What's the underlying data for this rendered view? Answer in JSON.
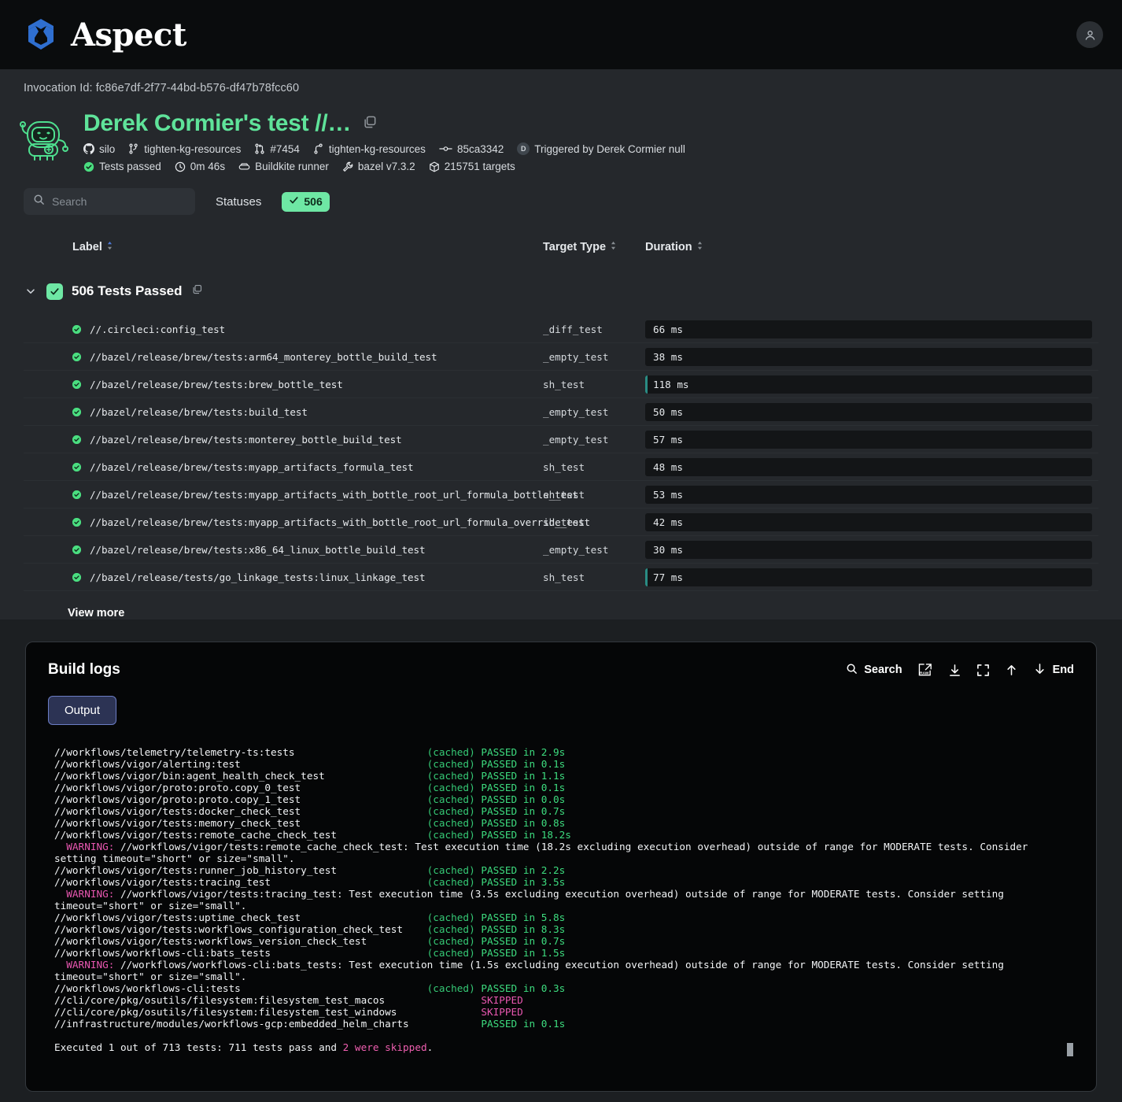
{
  "topbar": {
    "brand_name": "Aspect",
    "logo_icon": "aspect-logo-icon",
    "account_icon": "user-avatar-icon"
  },
  "invocation": {
    "id_text": "Invocation Id: fc86e7df-2f77-44bd-b576-df47b78fcc60",
    "mascot_icon": "robot-mascot-icon",
    "title": "Derek Cormier's test //…",
    "copy_icon": "copy-icon",
    "meta_line_1": [
      {
        "icon": "github-icon",
        "label": "silo"
      },
      {
        "icon": "git-branch-icon",
        "label": "tighten-kg-resources"
      },
      {
        "icon": "pull-request-icon",
        "label": "#7454"
      },
      {
        "icon": "git-branch-icon",
        "label": "tighten-kg-resources"
      },
      {
        "icon": "git-commit-icon",
        "label": "85ca3342"
      },
      {
        "icon": "user-avatar-chip",
        "label": "Triggered by Derek Cormier null",
        "chip": "D"
      }
    ],
    "meta_line_2": [
      {
        "icon": "check-circle-icon",
        "label": "Tests passed"
      },
      {
        "icon": "clock-icon",
        "label": "0m 46s"
      },
      {
        "icon": "runner-icon",
        "label": "Buildkite runner"
      },
      {
        "icon": "wrench-icon",
        "label": "bazel v7.3.2"
      },
      {
        "icon": "package-icon",
        "label": "215751 targets"
      }
    ]
  },
  "filters": {
    "search_placeholder": "Search",
    "search_value": "",
    "search_icon": "search-icon",
    "statuses_label": "Statuses",
    "status_chip": {
      "icon": "check-icon",
      "count": "506"
    }
  },
  "table": {
    "columns": [
      {
        "key": "label",
        "label": "Label",
        "sort_icon": "sort-icon"
      },
      {
        "key": "target_type",
        "label": "Target Type",
        "sort_icon": "sort-icon"
      },
      {
        "key": "duration",
        "label": "Duration",
        "sort_icon": "sort-icon"
      }
    ],
    "group": {
      "chevron_icon": "chevron-down-icon",
      "check_icon": "check-icon",
      "title": "506 Tests Passed",
      "copy_icon": "copy-icon"
    },
    "rows": [
      {
        "status_icon": "pass-check-icon",
        "label": "//.circleci:config_test",
        "target_type": "_diff_test",
        "duration": "66 ms",
        "bar_pct": 0
      },
      {
        "status_icon": "pass-check-icon",
        "label": "//bazel/release/brew/tests:arm64_monterey_bottle_build_test",
        "target_type": "_empty_test",
        "duration": "38 ms",
        "bar_pct": 0
      },
      {
        "status_icon": "pass-check-icon",
        "label": "//bazel/release/brew/tests:brew_bottle_test",
        "target_type": "sh_test",
        "duration": "118 ms",
        "bar_pct": 1
      },
      {
        "status_icon": "pass-check-icon",
        "label": "//bazel/release/brew/tests:build_test",
        "target_type": "_empty_test",
        "duration": "50 ms",
        "bar_pct": 0
      },
      {
        "status_icon": "pass-check-icon",
        "label": "//bazel/release/brew/tests:monterey_bottle_build_test",
        "target_type": "_empty_test",
        "duration": "57 ms",
        "bar_pct": 0
      },
      {
        "status_icon": "pass-check-icon",
        "label": "//bazel/release/brew/tests:myapp_artifacts_formula_test",
        "target_type": "sh_test",
        "duration": "48 ms",
        "bar_pct": 0
      },
      {
        "status_icon": "pass-check-icon",
        "label": "//bazel/release/brew/tests:myapp_artifacts_with_bottle_root_url_formula_bottle_test",
        "target_type": "sh_test",
        "duration": "53 ms",
        "bar_pct": 0
      },
      {
        "status_icon": "pass-check-icon",
        "label": "//bazel/release/brew/tests:myapp_artifacts_with_bottle_root_url_formula_override_test",
        "target_type": "sh_test",
        "duration": "42 ms",
        "bar_pct": 0
      },
      {
        "status_icon": "pass-check-icon",
        "label": "//bazel/release/brew/tests:x86_64_linux_bottle_build_test",
        "target_type": "_empty_test",
        "duration": "30 ms",
        "bar_pct": 0
      },
      {
        "status_icon": "pass-check-icon",
        "label": "//bazel/release/tests/go_linkage_tests:linux_linkage_test",
        "target_type": "sh_test",
        "duration": "77 ms",
        "bar_pct": 1
      }
    ],
    "view_more_label": "View more"
  },
  "build_logs": {
    "title": "Build logs",
    "tools": [
      {
        "icon": "search-icon",
        "label": "Search"
      },
      {
        "icon": "raw-external-link-icon",
        "label": ""
      },
      {
        "icon": "download-icon",
        "label": ""
      },
      {
        "icon": "fullscreen-icon",
        "label": ""
      },
      {
        "icon": "arrow-up-icon",
        "label": ""
      },
      {
        "icon": "arrow-down-icon",
        "label": "End"
      }
    ],
    "tabs": [
      {
        "label": "Output",
        "active": true
      }
    ],
    "lines": [
      {
        "type": "result",
        "target": "//workflows/telemetry/telemetry-ts:tests",
        "cached": "(cached)",
        "status": "PASSED in 2.9s"
      },
      {
        "type": "result",
        "target": "//workflows/vigor/alerting:test",
        "cached": "(cached)",
        "status": "PASSED in 0.1s"
      },
      {
        "type": "result",
        "target": "//workflows/vigor/bin:agent_health_check_test",
        "cached": "(cached)",
        "status": "PASSED in 1.1s"
      },
      {
        "type": "result",
        "target": "//workflows/vigor/proto:proto.copy_0_test",
        "cached": "(cached)",
        "status": "PASSED in 0.1s"
      },
      {
        "type": "result",
        "target": "//workflows/vigor/proto:proto.copy_1_test",
        "cached": "(cached)",
        "status": "PASSED in 0.0s"
      },
      {
        "type": "result",
        "target": "//workflows/vigor/tests:docker_check_test",
        "cached": "(cached)",
        "status": "PASSED in 0.7s"
      },
      {
        "type": "result",
        "target": "//workflows/vigor/tests:memory_check_test",
        "cached": "(cached)",
        "status": "PASSED in 0.8s"
      },
      {
        "type": "result",
        "target": "//workflows/vigor/tests:remote_cache_check_test",
        "cached": "(cached)",
        "status": "PASSED in 18.2s"
      },
      {
        "type": "warning",
        "prefix": "  WARNING: ",
        "text": "//workflows/vigor/tests:remote_cache_check_test: Test execution time (18.2s excluding execution overhead) outside of range for MODERATE tests. Consider setting timeout=\"short\" or size=\"small\"."
      },
      {
        "type": "result",
        "target": "//workflows/vigor/tests:runner_job_history_test",
        "cached": "(cached)",
        "status": "PASSED in 2.2s"
      },
      {
        "type": "result",
        "target": "//workflows/vigor/tests:tracing_test",
        "cached": "(cached)",
        "status": "PASSED in 3.5s"
      },
      {
        "type": "warning",
        "prefix": "  WARNING: ",
        "text": "//workflows/vigor/tests:tracing_test: Test execution time (3.5s excluding execution overhead) outside of range for MODERATE tests. Consider setting timeout=\"short\" or size=\"small\"."
      },
      {
        "type": "result",
        "target": "//workflows/vigor/tests:uptime_check_test",
        "cached": "(cached)",
        "status": "PASSED in 5.8s"
      },
      {
        "type": "result",
        "target": "//workflows/vigor/tests:workflows_configuration_check_test",
        "cached": "(cached)",
        "status": "PASSED in 8.3s"
      },
      {
        "type": "result",
        "target": "//workflows/vigor/tests:workflows_version_check_test",
        "cached": "(cached)",
        "status": "PASSED in 0.7s"
      },
      {
        "type": "result",
        "target": "//workflows/workflows-cli:bats_tests",
        "cached": "(cached)",
        "status": "PASSED in 1.5s"
      },
      {
        "type": "warning",
        "prefix": "  WARNING: ",
        "text": "//workflows/workflows-cli:bats_tests: Test execution time (1.5s excluding execution overhead) outside of range for MODERATE tests. Consider setting timeout=\"short\" or size=\"small\"."
      },
      {
        "type": "result",
        "target": "//workflows/workflows-cli:tests",
        "cached": "(cached)",
        "status": "PASSED in 0.3s"
      },
      {
        "type": "skipped",
        "target": "//cli/core/pkg/osutils/filesystem:filesystem_test_macos",
        "cached": "",
        "status": "SKIPPED"
      },
      {
        "type": "skipped",
        "target": "//cli/core/pkg/osutils/filesystem:filesystem_test_windows",
        "cached": "",
        "status": "SKIPPED"
      },
      {
        "type": "result",
        "target": "//infrastructure/modules/workflows-gcp:embedded_helm_charts",
        "cached": "",
        "status": "PASSED in 0.1s"
      }
    ],
    "summary": {
      "prefix": "Executed 1 out of 713 tests: 711 tests pass and ",
      "highlight": "2 were skipped",
      "suffix": "."
    }
  },
  "colors": {
    "accent_green": "#5fe39a",
    "chip_green": "#6ee7a4",
    "log_green": "#3ddc7f",
    "log_magenta": "#e857b0",
    "tab_blue": "#6b7cc4",
    "bar_teal": "#2a8c84"
  }
}
